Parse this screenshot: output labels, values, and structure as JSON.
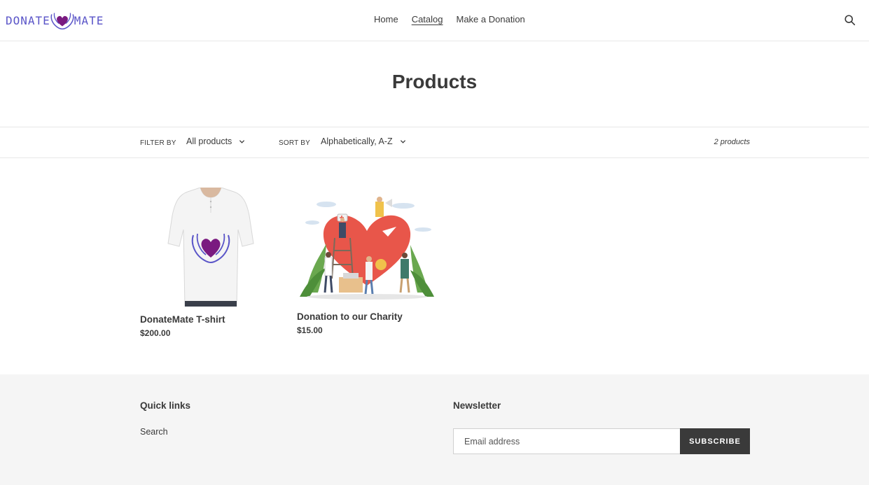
{
  "header": {
    "logo": {
      "left_text": "DONATE",
      "right_text": "MATE"
    },
    "nav": [
      {
        "label": "Home",
        "active": false
      },
      {
        "label": "Catalog",
        "active": true
      },
      {
        "label": "Make a Donation",
        "active": false
      }
    ]
  },
  "page_title": "Products",
  "filters": {
    "filter_label": "FILTER BY",
    "filter_value": "All products",
    "sort_label": "SORT BY",
    "sort_value": "Alphabetically, A-Z",
    "count": "2 products"
  },
  "products": [
    {
      "name": "DonateMate T-shirt",
      "price": "$200.00"
    },
    {
      "name": "Donation to our Charity",
      "price": "$15.00"
    }
  ],
  "footer": {
    "quick_links_heading": "Quick links",
    "quick_links": [
      "Search"
    ],
    "newsletter_heading": "Newsletter",
    "email_placeholder": "Email address",
    "subscribe_label": "SUBSCRIBE"
  },
  "colors": {
    "brand": "#5a55c8",
    "heart": "#7a1a80",
    "text": "#3a3a3a",
    "footer_bg": "#f5f5f5",
    "button_bg": "#3a3a3a"
  }
}
